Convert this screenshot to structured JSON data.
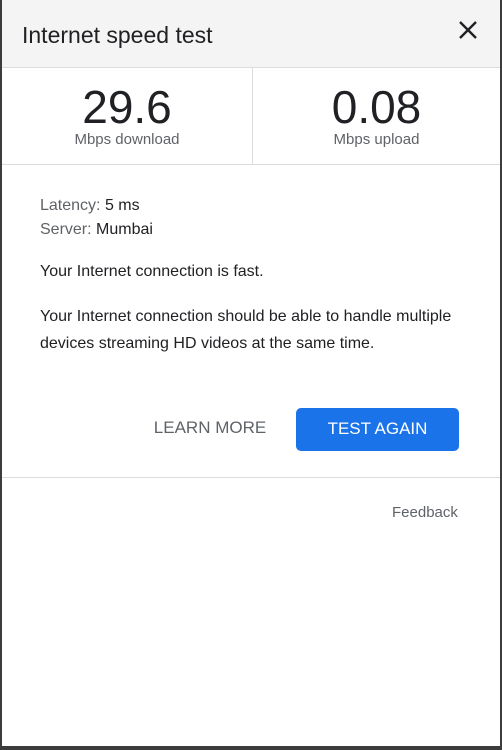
{
  "dialog": {
    "title": "Internet speed test",
    "close_icon": "close-icon"
  },
  "download": {
    "value": "29.6",
    "unit": "Mbps download"
  },
  "upload": {
    "value": "0.08",
    "unit": "Mbps upload"
  },
  "details": {
    "latency_label": "Latency:",
    "latency_value": "5 ms",
    "server_label": "Server:",
    "server_value": "Mumbai"
  },
  "messages": {
    "summary": "Your Internet connection is fast.",
    "description": "Your Internet connection should be able to handle multiple devices streaming HD videos at the same time."
  },
  "actions": {
    "learn_more": "LEARN MORE",
    "test_again": "TEST AGAIN"
  },
  "footer": {
    "feedback": "Feedback"
  },
  "colors": {
    "accent": "#1a73e8",
    "header_bg": "#f4f4f4",
    "divider": "#dadce0"
  }
}
